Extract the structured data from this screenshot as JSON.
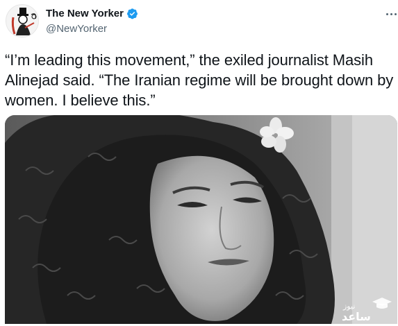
{
  "account": {
    "display_name": "The New Yorker",
    "handle": "@NewYorker",
    "verified": true,
    "avatar_icon": "eustace-tilley-logo-icon"
  },
  "tweet": {
    "text": "“I’m leading this movement,” the exiled journalist Masih Alinejad said. “The Iranian regime will be brought down by women. I believe this.”"
  },
  "media": {
    "description_icon": "woman-portrait-photo",
    "watermark_text": "ساعد نیوز"
  },
  "colors": {
    "text": "#0f1419",
    "secondary": "#536471",
    "verified_blue": "#1d9bf0"
  }
}
